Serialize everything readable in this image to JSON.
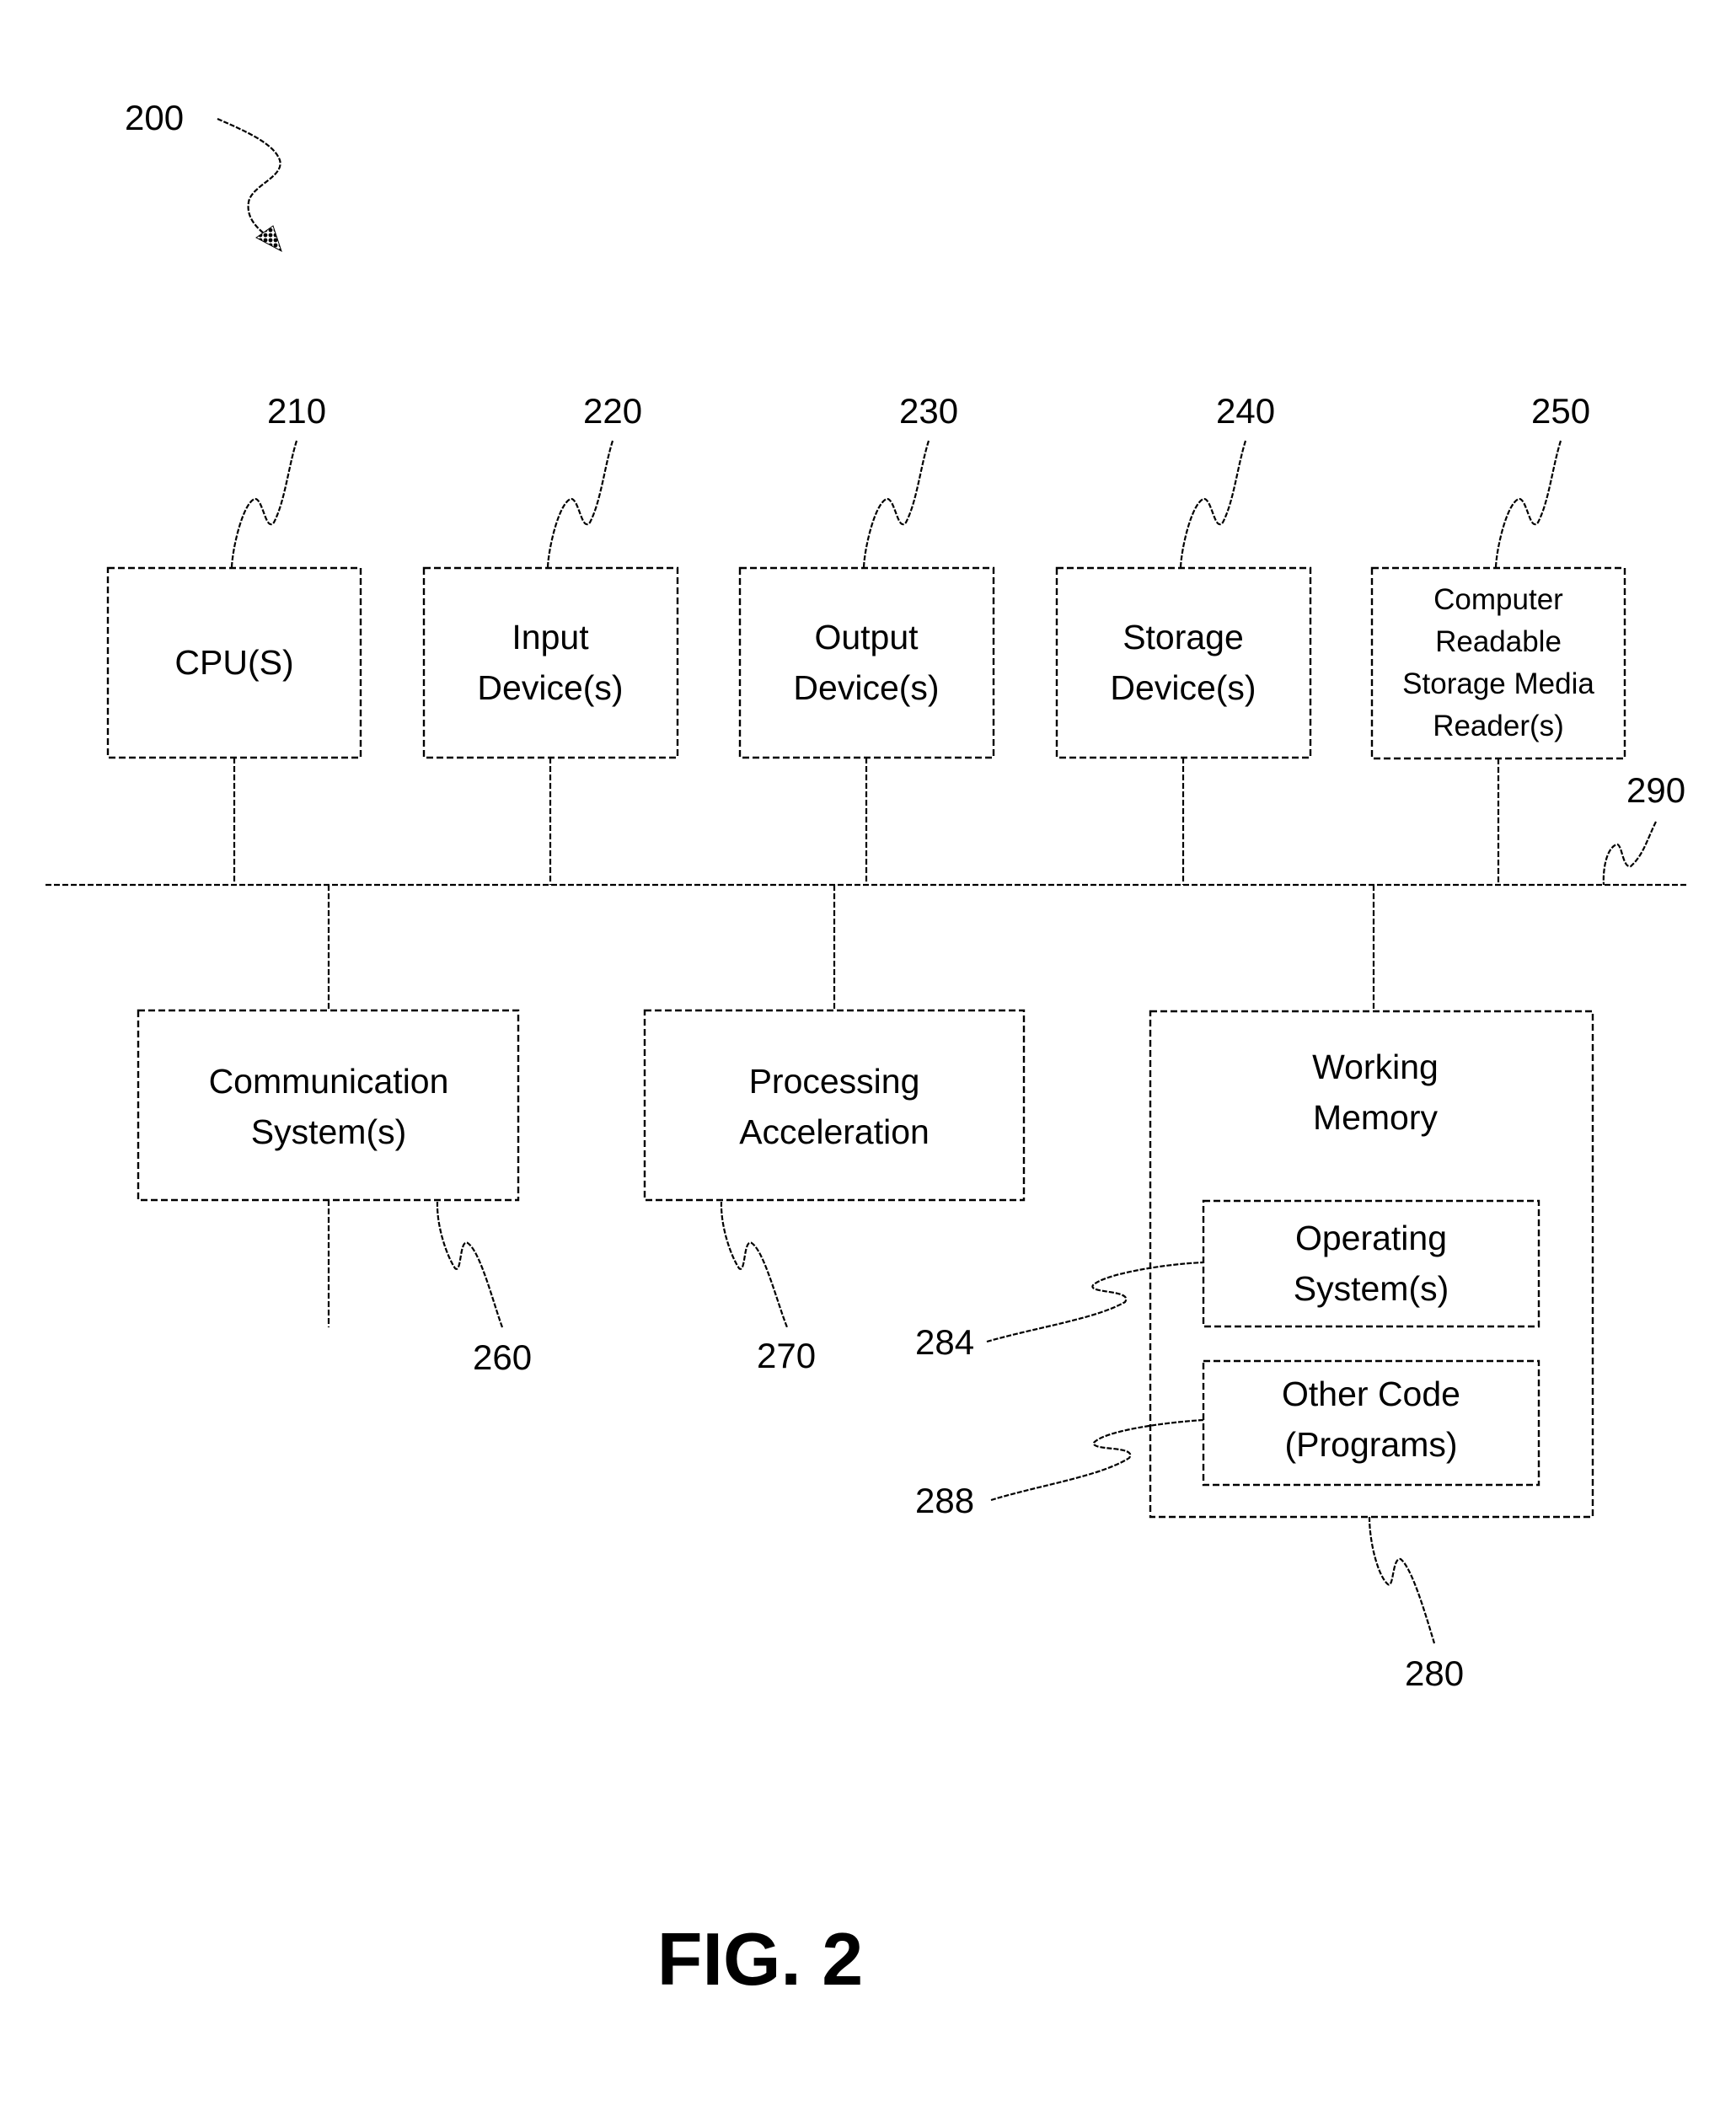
{
  "figure": {
    "caption": "FIG. 2",
    "system_ref": "200",
    "bus_ref": "290"
  },
  "components": {
    "cpu": {
      "ref": "210",
      "lines": [
        "CPU(S)"
      ]
    },
    "input": {
      "ref": "220",
      "lines": [
        "Input",
        "Device(s)"
      ]
    },
    "output": {
      "ref": "230",
      "lines": [
        "Output",
        "Device(s)"
      ]
    },
    "storage": {
      "ref": "240",
      "lines": [
        "Storage",
        "Device(s)"
      ]
    },
    "crsm_reader": {
      "ref": "250",
      "lines": [
        "Computer",
        "Readable",
        "Storage Media",
        "Reader(s)"
      ]
    },
    "communication": {
      "ref": "260",
      "lines": [
        "Communication",
        "System(s)"
      ]
    },
    "processing_accel": {
      "ref": "270",
      "lines": [
        "Processing",
        "Acceleration"
      ]
    },
    "working_memory": {
      "ref": "280",
      "lines": [
        "Working",
        "Memory"
      ]
    },
    "operating_system": {
      "ref": "284",
      "lines": [
        "Operating",
        "System(s)"
      ]
    },
    "other_code": {
      "ref": "288",
      "lines": [
        "Other Code",
        "(Programs)"
      ]
    }
  },
  "colors": {
    "line": "#000000",
    "background": "#ffffff"
  }
}
